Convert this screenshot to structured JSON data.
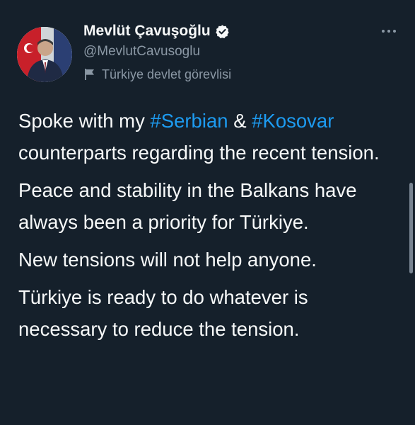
{
  "author": {
    "display_name": "Mevlüt Çavuşoğlu",
    "handle": "@MevlutCavusoglu",
    "label": "Türkiye devlet görevlisi"
  },
  "menu": {
    "more_glyph": "•••"
  },
  "tweet": {
    "p1_before": "Spoke with my ",
    "p1_hashtag1": "#Serbian",
    "p1_amp": " & ",
    "p1_hashtag2": "#Kosovar",
    "p1_after": " counterparts regarding the recent tension.",
    "p2": "Peace and stability in the Balkans have always been a priority for Türkiye.",
    "p3": "New tensions will not help anyone.",
    "p4": "Türkiye is ready to do whatever is necessary to reduce the tension."
  },
  "colors": {
    "background": "#15202b",
    "text": "#f7f9f9",
    "secondary": "#8b98a5",
    "link": "#1d9bf0",
    "verified_badge": "#f7f9f9"
  }
}
